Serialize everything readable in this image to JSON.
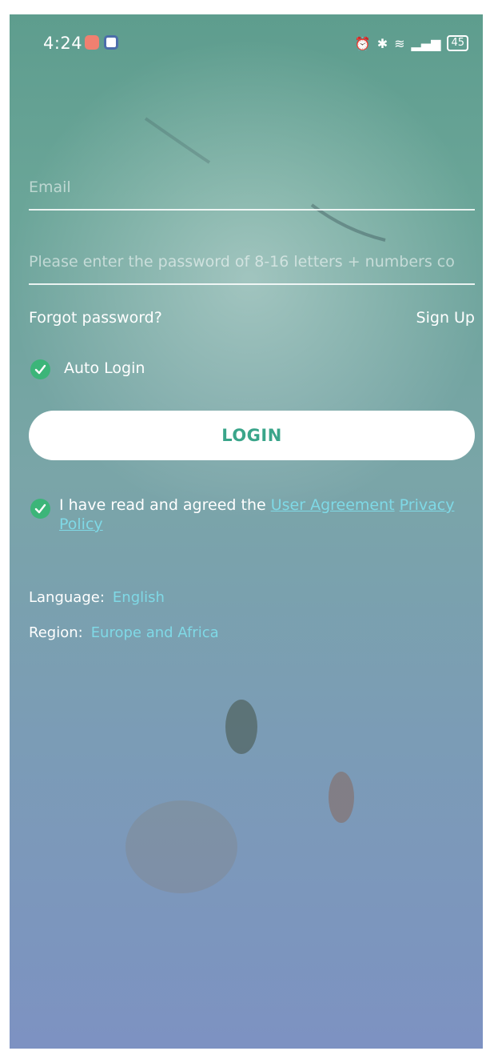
{
  "status_bar": {
    "time": "4:24",
    "battery": "45",
    "icons": [
      "notification-app-icon",
      "notification-app-icon-2",
      "alarm-icon",
      "bluetooth-icon",
      "wifi-icon",
      "signal-icon",
      "battery-icon"
    ]
  },
  "form": {
    "email_placeholder": "Email",
    "password_placeholder": "Please enter the password of 8-16 letters + numbers co",
    "forgot_password": "Forgot password?",
    "sign_up": "Sign Up",
    "auto_login": "Auto Login",
    "auto_login_checked": true,
    "login_button": "LOGIN"
  },
  "agreement": {
    "checked": true,
    "text": "I have read and agreed the",
    "user_agreement": "User Agreement",
    "privacy_policy_1": "Privacy",
    "privacy_policy_2": "Policy"
  },
  "settings": {
    "language_label": "Language:",
    "language_value": "English",
    "region_label": "Region:",
    "region_value": "Europe and Africa"
  },
  "colors": {
    "accent_green": "#3cb579",
    "link_cyan": "#7fd9e6",
    "login_text": "#3aa58a"
  }
}
